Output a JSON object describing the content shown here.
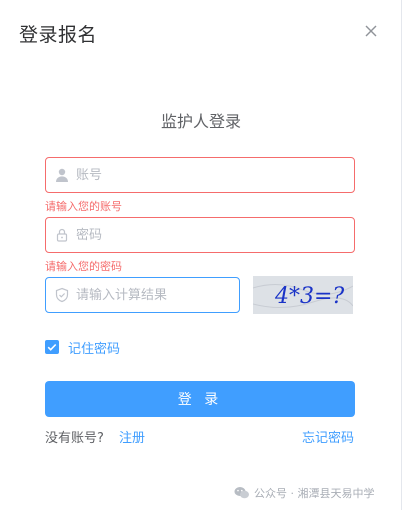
{
  "dialog": {
    "title": "登录报名",
    "subtitle": "监护人登录",
    "close_icon": "close-icon"
  },
  "form": {
    "account": {
      "placeholder": "账号",
      "value": "",
      "error": "请输入您的账号",
      "icon": "user-icon"
    },
    "password": {
      "placeholder": "密码",
      "value": "",
      "error": "请输入您的密码",
      "icon": "lock-icon"
    },
    "captcha": {
      "placeholder": "请输入计算结果",
      "value": "",
      "icon": "shield-icon",
      "image_text": "4*3=?"
    },
    "remember": {
      "label": "记住密码",
      "checked": true
    },
    "login_label": "登 录",
    "no_account_text": "没有账号?",
    "register_label": "注册",
    "forgot_label": "忘记密码"
  },
  "watermark": {
    "text": "公众号 · 湘潭县天易中学",
    "icon": "wechat-icon"
  },
  "colors": {
    "primary": "#409eff",
    "error": "#f56c6c",
    "text": "#303133"
  }
}
